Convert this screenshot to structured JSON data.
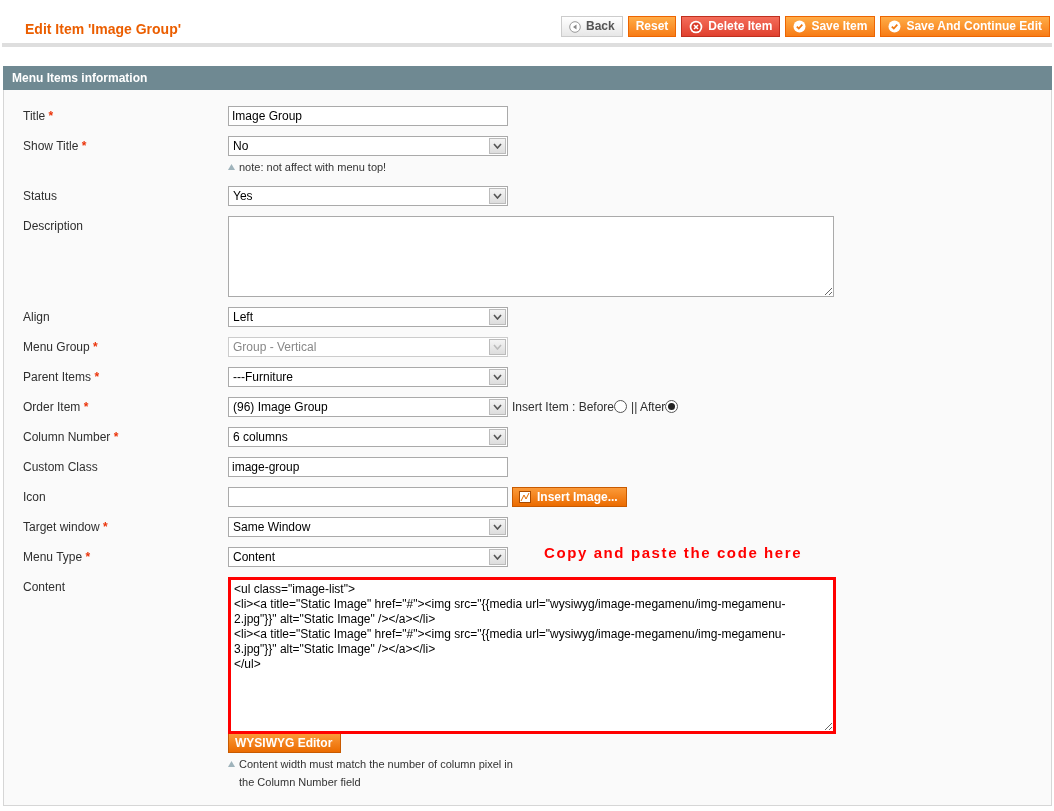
{
  "page_title": "Edit Item 'Image Group'",
  "actions": [
    {
      "kind": "back",
      "label": "Back"
    },
    {
      "kind": "plain",
      "label": "Reset"
    },
    {
      "kind": "delete",
      "label": "Delete Item"
    },
    {
      "kind": "save",
      "label": "Save Item"
    },
    {
      "kind": "save",
      "label": "Save And Continue Edit"
    }
  ],
  "section": {
    "title": "Menu Items information",
    "fields": [
      {
        "label": "Title",
        "mark": "*",
        "kind": "text",
        "value": "Image Group"
      },
      {
        "label": "Show Title",
        "mark": "*",
        "kind": "select",
        "value": "No",
        "disabled": false,
        "note": "note: not affect with menu top!"
      },
      {
        "label": "Status",
        "kind": "select",
        "value": "Yes",
        "disabled": false
      },
      {
        "label": "Description",
        "kind": "textarea",
        "highlighted": false
      },
      {
        "label": "Align",
        "kind": "select",
        "value": "Left",
        "disabled": false
      },
      {
        "label": "Menu Group",
        "mark": "*",
        "kind": "select",
        "value": "Group - Vertical",
        "disabled": true
      },
      {
        "label": "Parent Items",
        "mark": "*",
        "kind": "select",
        "value": "---Furniture",
        "disabled": false
      },
      {
        "label": "Order Item",
        "mark": "*",
        "kind": "select",
        "value": "(96) Image Group",
        "disabled": false,
        "extras": [
          {
            "kind": "text",
            "text": "Insert Item : Before"
          },
          {
            "kind": "radio",
            "selected": false
          },
          {
            "kind": "text",
            "text": "|| After"
          },
          {
            "kind": "radio",
            "selected": true
          }
        ]
      },
      {
        "label": "Column Number",
        "mark": "*",
        "kind": "select",
        "value": "6 columns",
        "disabled": false
      },
      {
        "label": "Custom Class",
        "kind": "text",
        "value": "image-group"
      },
      {
        "label": "Icon",
        "kind": "text",
        "extras": [
          {
            "kind": "button",
            "text": "Insert Image..."
          }
        ]
      },
      {
        "label": "Target window",
        "mark": "*",
        "kind": "select",
        "value": "Same Window",
        "disabled": false
      },
      {
        "label": "Menu Type",
        "mark": "*",
        "kind": "select",
        "value": "Content",
        "disabled": false,
        "annotation": "Copy and paste the code here"
      },
      {
        "label": "Content",
        "kind": "textarea",
        "highlighted": true,
        "value": "<ul class=\"image-list\">\n<li><a title=\"Static Image\" href=\"#\"><img src=\"{{media url=\"wysiwyg/image-megamenu/img-megamenu-2.jpg\"}}\" alt=\"Static Image\" /></a></li>\n<li><a title=\"Static Image\" href=\"#\"><img src=\"{{media url=\"wysiwyg/image-megamenu/img-megamenu-3.jpg\"}}\" alt=\"Static Image\" /></a></li>\n</ul>",
        "button": "WYSIWYG Editor",
        "note": "Content width must match the number of column pixel in the Column Number field"
      }
    ]
  }
}
